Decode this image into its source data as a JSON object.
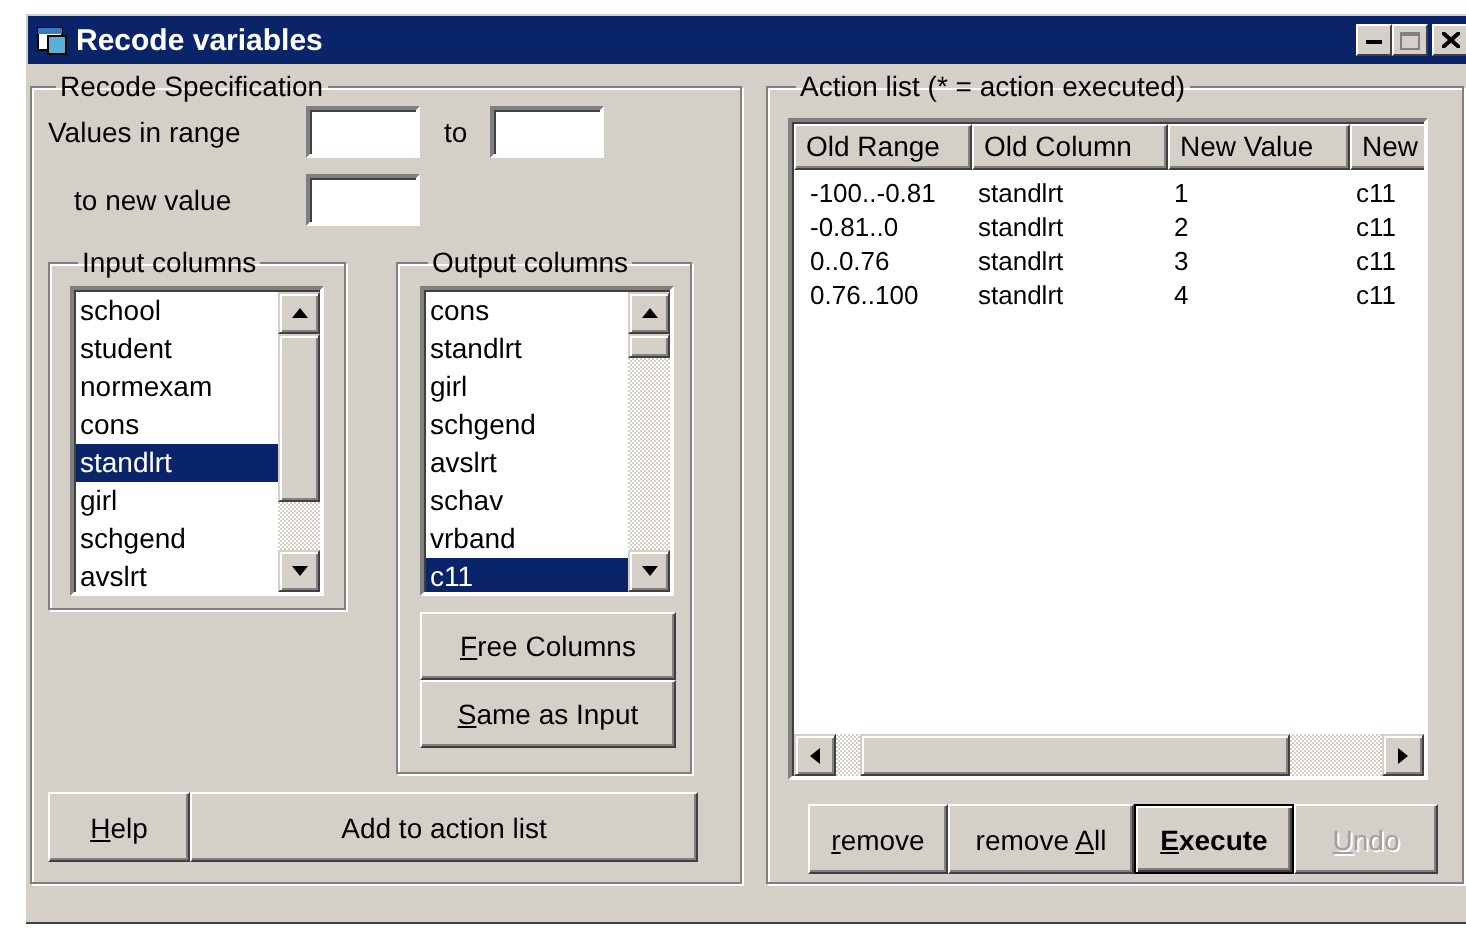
{
  "window": {
    "title": "Recode variables"
  },
  "recode_specification": {
    "title": "Recode Specification",
    "range_label": "Values in range",
    "to_label": "to",
    "new_value_label": "to new value"
  },
  "input_columns": {
    "title": "Input columns",
    "items": [
      {
        "label": "school",
        "selected": false
      },
      {
        "label": "student",
        "selected": false
      },
      {
        "label": "normexam",
        "selected": false
      },
      {
        "label": "cons",
        "selected": false
      },
      {
        "label": "standlrt",
        "selected": true
      },
      {
        "label": "girl",
        "selected": false
      },
      {
        "label": "schgend",
        "selected": false
      },
      {
        "label": "avslrt",
        "selected": false
      }
    ]
  },
  "output_columns": {
    "title": "Output columns",
    "items": [
      {
        "label": "cons",
        "selected": false
      },
      {
        "label": "standlrt",
        "selected": false
      },
      {
        "label": "girl",
        "selected": false
      },
      {
        "label": "schgend",
        "selected": false
      },
      {
        "label": "avslrt",
        "selected": false
      },
      {
        "label": "schav",
        "selected": false
      },
      {
        "label": "vrband",
        "selected": false
      },
      {
        "label": "c11",
        "selected": true
      }
    ]
  },
  "output_buttons": [
    {
      "key": "F",
      "post": "ree Columns"
    },
    {
      "key": "S",
      "post": "ame as Input"
    }
  ],
  "bottom_buttons": [
    {
      "key": "H",
      "post": "elp",
      "kind": "small"
    },
    {
      "pre": "Add to action list",
      "kind": "wide"
    }
  ],
  "action_list": {
    "title": "Action list (* = action executed)",
    "columns": [
      "Old Range",
      "Old Column",
      "New Value",
      "New"
    ],
    "rows": [
      [
        "-100..-0.81",
        "standlrt",
        "1",
        "c11"
      ],
      [
        "-0.81..0",
        "standlrt",
        "2",
        "c11"
      ],
      [
        "0..0.76",
        "standlrt",
        "3",
        "c11"
      ],
      [
        "0.76..100",
        "standlrt",
        "4",
        "c11"
      ]
    ]
  },
  "action_buttons": [
    {
      "key": "r",
      "post": "emove",
      "default": false,
      "disabled": false
    },
    {
      "pre": "remove ",
      "key": "A",
      "post": "ll",
      "default": false,
      "disabled": false
    },
    {
      "key": "E",
      "post": "xecute",
      "default": true,
      "disabled": false
    },
    {
      "key": "U",
      "post": "ndo",
      "default": false,
      "disabled": true
    }
  ]
}
